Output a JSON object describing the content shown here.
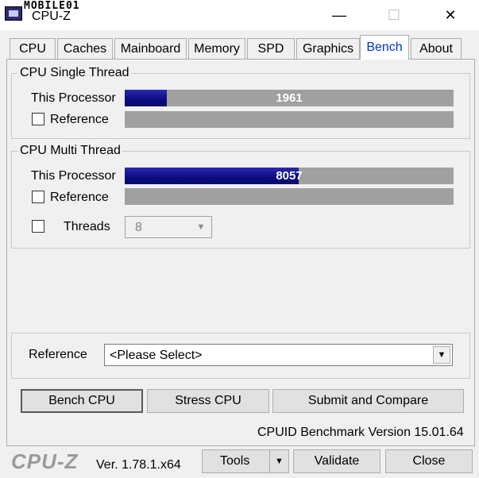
{
  "window": {
    "title": "CPU-Z",
    "watermark": "MOBILE01",
    "minimize_glyph": "—",
    "maximize_glyph": "☐",
    "close_glyph": "✕"
  },
  "tabs": [
    {
      "label": "CPU"
    },
    {
      "label": "Caches"
    },
    {
      "label": "Mainboard"
    },
    {
      "label": "Memory"
    },
    {
      "label": "SPD"
    },
    {
      "label": "Graphics"
    },
    {
      "label": "Bench",
      "active": true
    },
    {
      "label": "About"
    }
  ],
  "single_thread": {
    "title": "CPU Single Thread",
    "this_processor_label": "This Processor",
    "score": "1961",
    "score_fraction": 0.129,
    "reference_label": "Reference",
    "reference_checked": false
  },
  "multi_thread": {
    "title": "CPU Multi Thread",
    "this_processor_label": "This Processor",
    "score": "8057",
    "score_fraction": 0.53,
    "reference_label": "Reference",
    "reference_checked": false,
    "threads_label": "Threads",
    "threads_checked": false,
    "threads_value": "8"
  },
  "reference_select": {
    "label": "Reference",
    "value": "<Please Select>"
  },
  "buttons": {
    "bench_cpu": "Bench CPU",
    "stress_cpu": "Stress CPU",
    "submit_compare": "Submit and Compare"
  },
  "benchmark_version": "CPUID Benchmark Version 15.01.64",
  "footer": {
    "logo": "CPU-Z",
    "version": "Ver. 1.78.1.x64",
    "tools": "Tools",
    "validate": "Validate",
    "close": "Close"
  },
  "colors": {
    "bar_fill": "#0b0b80",
    "bar_track": "#a0a0a0",
    "active_tab_text": "#0033cc"
  }
}
